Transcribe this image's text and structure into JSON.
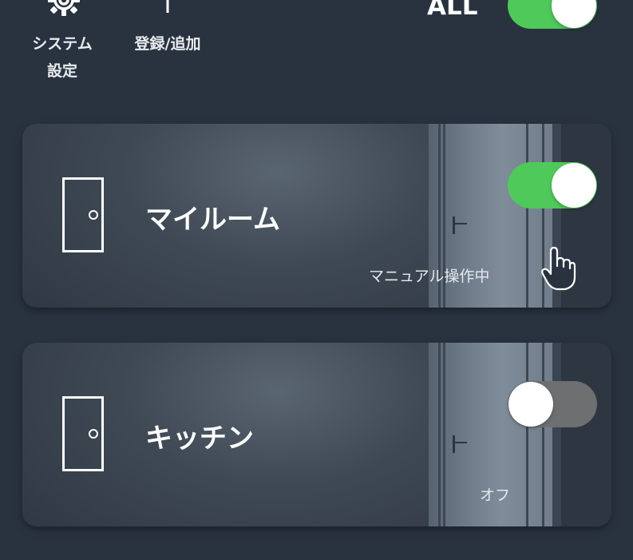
{
  "toolbar": {
    "system_settings": {
      "label": "システム\n設定",
      "icon": "gear-icon"
    },
    "register_add": {
      "label": "登録/追加",
      "icon": "plus-icon"
    },
    "all": {
      "label": "ALL",
      "state": "on"
    }
  },
  "rooms": [
    {
      "name": "マイルーム",
      "status": "マニュアル操作中",
      "toggle": "on"
    },
    {
      "name": "キッチン",
      "status": "オフ",
      "toggle": "off"
    }
  ],
  "colors": {
    "background": "#293340",
    "toggle_on": "#4fc95a",
    "toggle_off": "#6d6f71"
  }
}
